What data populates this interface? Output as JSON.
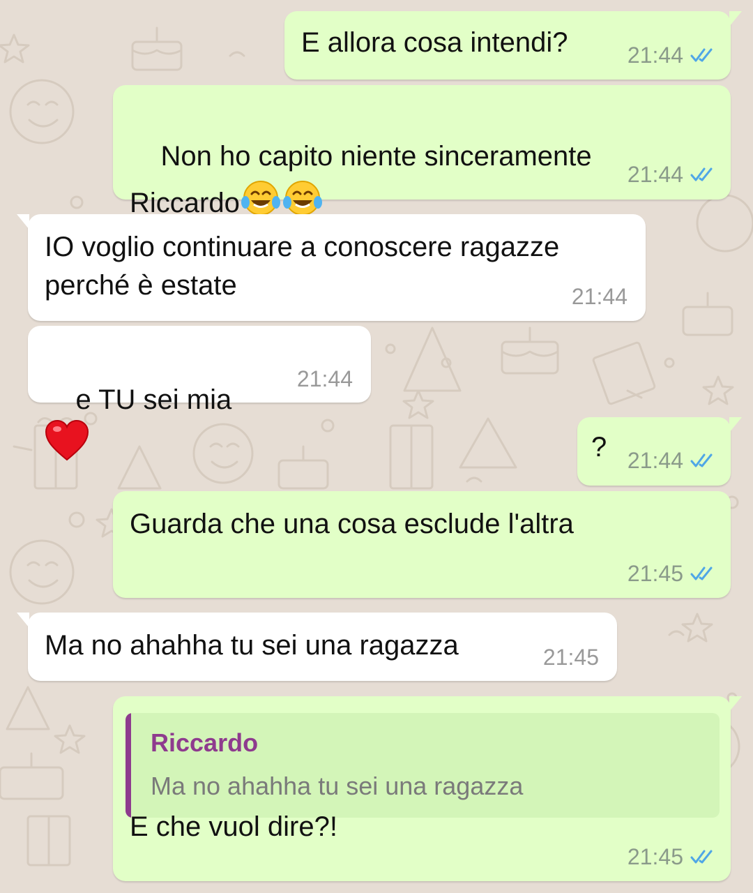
{
  "theme": {
    "outgoing_bubble": "#e2ffc7",
    "incoming_bubble": "#ffffff",
    "wallpaper": "#e6ddd4",
    "read_tick_color": "#4fa6e6",
    "quote_author_color": "#8e3b8e"
  },
  "messages": [
    {
      "direction": "outgoing",
      "text": "E allora cosa intendi?",
      "time": "21:44",
      "status": "read-double-tick"
    },
    {
      "direction": "outgoing",
      "text": "Non ho capito niente sinceramente\nRiccardo",
      "emojis": [
        "face-with-tears-of-joy",
        "face-with-tears-of-joy"
      ],
      "time": "21:44",
      "status": "read-double-tick"
    },
    {
      "direction": "incoming",
      "text": "IO voglio continuare a conoscere ragazze\nperché è estate",
      "time": "21:44"
    },
    {
      "direction": "incoming",
      "text": "e TU sei mia",
      "emojis": [
        "red-heart"
      ],
      "time": "21:44"
    },
    {
      "direction": "outgoing",
      "text": "?",
      "time": "21:44",
      "status": "read-double-tick"
    },
    {
      "direction": "outgoing",
      "text": "Guarda che una cosa esclude l'altra",
      "time": "21:45",
      "status": "read-double-tick"
    },
    {
      "direction": "incoming",
      "text": "Ma no ahahha tu sei una ragazza",
      "time": "21:45"
    },
    {
      "direction": "outgoing",
      "quoted": {
        "author": "Riccardo",
        "text": "Ma no ahahha tu sei una ragazza"
      },
      "text": "E che vuol dire?!",
      "time": "21:45",
      "status": "read-double-tick"
    }
  ]
}
